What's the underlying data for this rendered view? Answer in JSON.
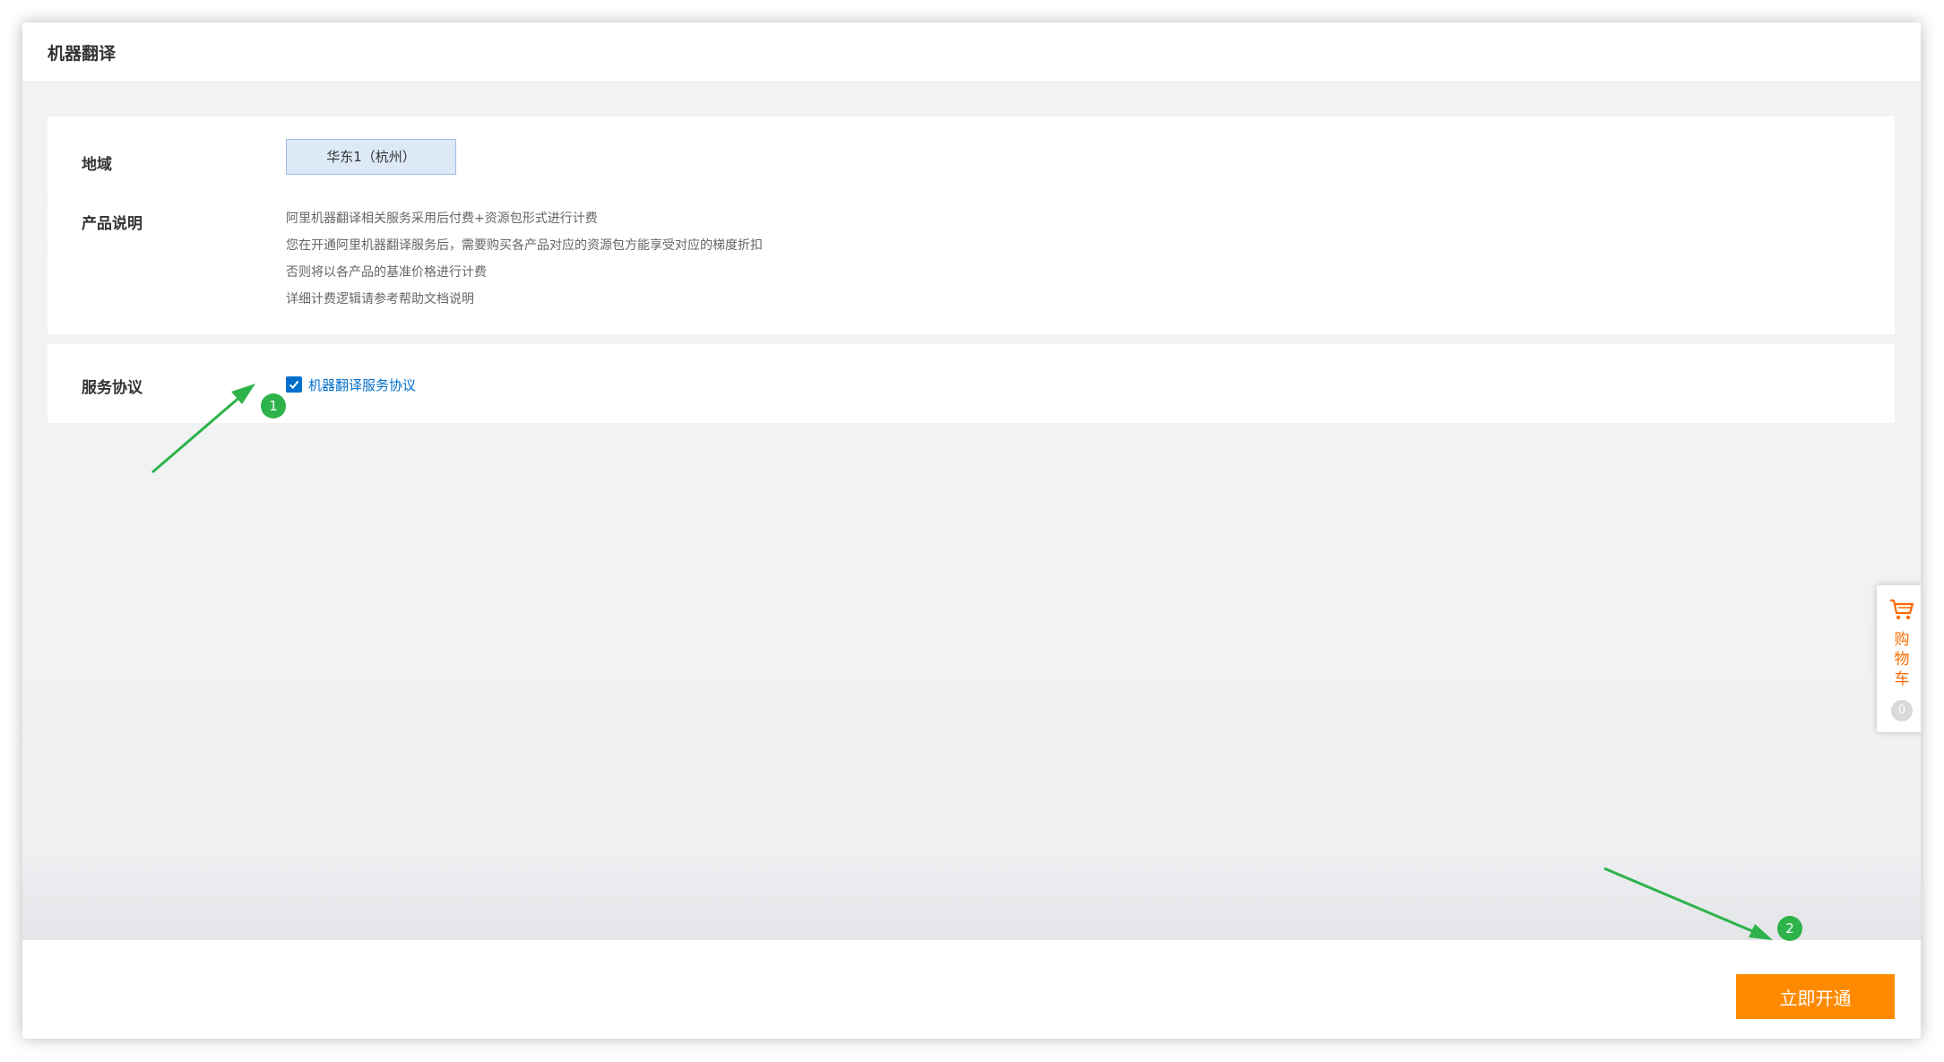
{
  "header": {
    "title": "机器翻译"
  },
  "region": {
    "label": "地域",
    "selected": "华东1（杭州）"
  },
  "product": {
    "label": "产品说明",
    "lines": [
      "阿里机器翻译相关服务采用后付费+资源包形式进行计费",
      "您在开通阿里机器翻译服务后，需要购买各产品对应的资源包方能享受对应的梯度折扣",
      "否则将以各产品的基准价格进行计费",
      "详细计费逻辑请参考帮助文档说明"
    ]
  },
  "agreement": {
    "label": "服务协议",
    "checked": true,
    "link_text": "机器翻译服务协议"
  },
  "cart": {
    "label_chars": [
      "购",
      "物",
      "车"
    ],
    "count": "0",
    "icon": "shopping-cart-icon"
  },
  "footer": {
    "open_button": "立即开通"
  },
  "annotations": {
    "step1": "1",
    "step2": "2",
    "color": "#2db34a"
  },
  "colors": {
    "accent_orange": "#ff8a00",
    "link_blue": "#0070cc",
    "cart_orange": "#ff6a00"
  }
}
